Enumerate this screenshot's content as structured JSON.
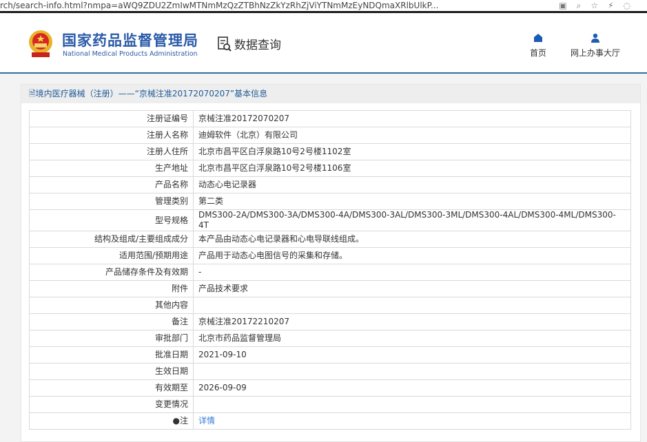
{
  "browser": {
    "url": "rch/search-info.html?nmpa=aWQ9ZDU2ZmIwMTNmMzQzZTBhNzZkYzRhZjViYTNmMzEyNDQmaXRlbUlkP..."
  },
  "header": {
    "logo_cn": "国家药品监督管理局",
    "logo_en": "National Medical Products Administration",
    "section": "数据查询",
    "nav": [
      {
        "label": "首页"
      },
      {
        "label": "网上办事大厅"
      }
    ]
  },
  "panel": {
    "title": "境内医疗器械（注册）——“京械注准20172070207”基本信息"
  },
  "rows": [
    {
      "label": "注册证编号",
      "value": "京械注准20172070207"
    },
    {
      "label": "注册人名称",
      "value": "迪姆软件（北京）有限公司"
    },
    {
      "label": "注册人住所",
      "value": "北京市昌平区白浮泉路10号2号楼1102室"
    },
    {
      "label": "生产地址",
      "value": "北京市昌平区白浮泉路10号2号楼1106室"
    },
    {
      "label": "产品名称",
      "value": "动态心电记录器"
    },
    {
      "label": "管理类别",
      "value": "第二类"
    },
    {
      "label": "型号规格",
      "value": "DMS300-2A/DMS300-3A/DMS300-4A/DMS300-3AL/DMS300-3ML/DMS300-4AL/DMS300-4ML/DMS300-4T"
    },
    {
      "label": "结构及组成/主要组成成分",
      "value": "本产品由动态心电记录器和心电导联线组成。"
    },
    {
      "label": "适用范围/预期用途",
      "value": "产品用于动态心电图信号的采集和存储。"
    },
    {
      "label": "产品储存条件及有效期",
      "value": "-"
    },
    {
      "label": "附件",
      "value": "产品技术要求"
    },
    {
      "label": "其他内容",
      "value": ""
    },
    {
      "label": "备注",
      "value": "京械注准20172210207"
    },
    {
      "label": "审批部门",
      "value": "北京市药品监督管理局"
    },
    {
      "label": "批准日期",
      "value": "2021-09-10"
    },
    {
      "label": "生效日期",
      "value": ""
    },
    {
      "label": "有效期至",
      "value": "2026-09-09"
    },
    {
      "label": "变更情况",
      "value": ""
    }
  ],
  "note": {
    "label": "注",
    "link": "详情"
  }
}
